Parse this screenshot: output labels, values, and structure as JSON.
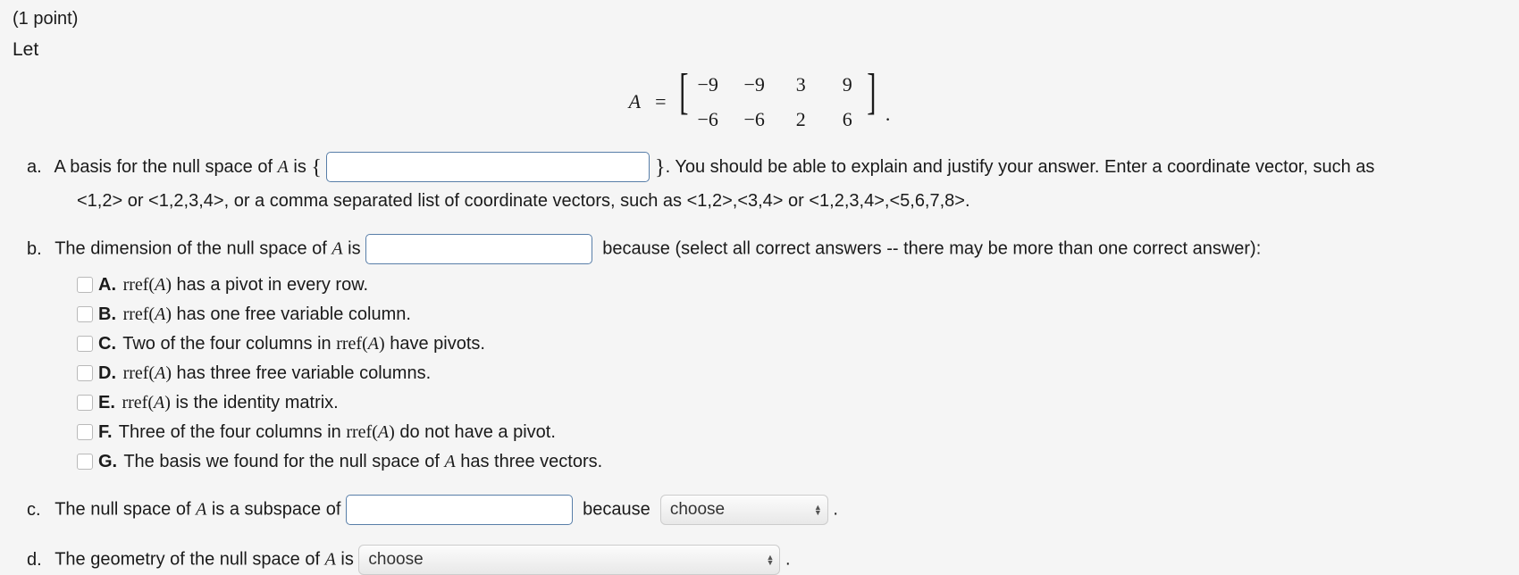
{
  "header": {
    "points_label": "(1 point)",
    "let_label": "Let"
  },
  "chart_data": {
    "type": "table",
    "name": "Matrix A",
    "rows": 2,
    "cols": 4,
    "values": [
      [
        -9,
        -9,
        3,
        9
      ],
      [
        -6,
        -6,
        2,
        6
      ]
    ]
  },
  "equation": {
    "lhs": "A",
    "eq": "=",
    "m": {
      "r0c0": "−9",
      "r0c1": "−9",
      "r0c2": "3",
      "r0c3": "9",
      "r1c0": "−6",
      "r1c1": "−6",
      "r1c2": "2",
      "r1c3": "6"
    },
    "period": "."
  },
  "parts": {
    "a": {
      "label": "a.",
      "pre": "A basis for the null space of ",
      "A": "A",
      "is": " is ",
      "lbrace": "{",
      "rbrace": "}",
      "after": ". You should be able to explain and justify your answer. Enter a coordinate vector, such as",
      "line2": "<1,2> or <1,2,3,4>, or a comma separated list of coordinate vectors, such as <1,2>,<3,4> or <1,2,3,4>,<5,6,7,8>.",
      "input": ""
    },
    "b": {
      "label": "b.",
      "pre": "The dimension of the null space of ",
      "A": "A",
      "is": " is ",
      "after": "because (select all correct answers -- there may be more than one correct answer):",
      "input": "",
      "options": {
        "A": {
          "letter": "A.",
          "pre": "",
          "rref": "rref(",
          "Avar": "A",
          "rparen": ")",
          "post": " has a pivot in every row."
        },
        "B": {
          "letter": "B.",
          "pre": "",
          "rref": "rref(",
          "Avar": "A",
          "rparen": ")",
          "post": " has one free variable column."
        },
        "C": {
          "letter": "C.",
          "pre": "Two of the four columns in ",
          "rref": "rref(",
          "Avar": "A",
          "rparen": ")",
          "post": " have pivots."
        },
        "D": {
          "letter": "D.",
          "pre": "",
          "rref": "rref(",
          "Avar": "A",
          "rparen": ")",
          "post": " has three free variable columns."
        },
        "E": {
          "letter": "E.",
          "pre": "",
          "rref": "rref(",
          "Avar": "A",
          "rparen": ")",
          "post": " is the identity matrix."
        },
        "F": {
          "letter": "F.",
          "pre": "Three of the four columns in ",
          "rref": "rref(",
          "Avar": "A",
          "rparen": ")",
          "post": " do not have a pivot."
        },
        "G": {
          "letter": "G.",
          "text": "The basis we found for the null space of ",
          "Avar": "A",
          "post": " has three vectors."
        }
      }
    },
    "c": {
      "label": "c.",
      "pre": "The null space of ",
      "A": "A",
      "mid": " is a subspace of ",
      "input": "",
      "because": "because",
      "select": "choose",
      "period": "."
    },
    "d": {
      "label": "d.",
      "pre": "The geometry of the null space of ",
      "A": "A",
      "is": " is ",
      "select": "choose",
      "period": "."
    }
  }
}
